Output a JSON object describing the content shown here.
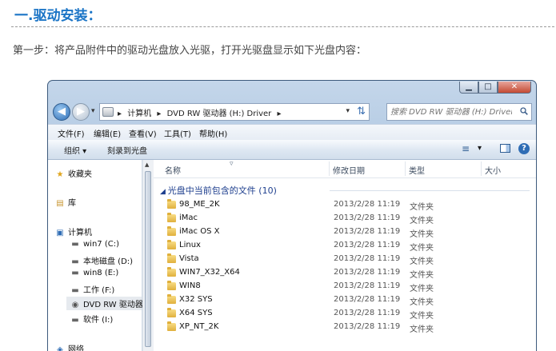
{
  "article": {
    "heading": "一.驱动安装：",
    "step_text": "第一步：将产品附件中的驱动光盘放入光驱，打开光驱盘显示如下光盘内容："
  },
  "window": {
    "controls": {
      "minimize": "▁",
      "maximize": "□",
      "close": "✕"
    },
    "address": {
      "crumbs": [
        "▸",
        "计算机",
        "▸",
        "DVD RW 驱动器 (H:) Driver",
        "▸"
      ]
    },
    "search": {
      "placeholder": "搜索 DVD RW 驱动器 (H:) Driver"
    },
    "menu": [
      "文件(F)",
      "编辑(E)",
      "查看(V)",
      "工具(T)",
      "帮助(H)"
    ],
    "toolbar": {
      "organize": "组织 ▾",
      "burn": "刻录到光盘",
      "views_arrow": "▾",
      "help": "?"
    },
    "nav": {
      "favorites": "收藏夹",
      "library": "库",
      "computer": "计算机",
      "drives": [
        "win7 (C:)",
        "本地磁盘 (D:)",
        "win8 (E:)",
        "工作 (F:)",
        "DVD RW 驱动器",
        "软件 (I:)"
      ],
      "network": "网络"
    },
    "columns": {
      "name": "名称",
      "modified": "修改日期",
      "type": "类型",
      "size": "大小"
    },
    "group_label": "光盘中当前包含的文件 (10)",
    "files": [
      {
        "name": "98_ME_2K",
        "date": "2013/2/28 11:19",
        "type": "文件夹"
      },
      {
        "name": "iMac",
        "date": "2013/2/28 11:19",
        "type": "文件夹"
      },
      {
        "name": "iMac OS X",
        "date": "2013/2/28 11:19",
        "type": "文件夹"
      },
      {
        "name": "Linux",
        "date": "2013/2/28 11:19",
        "type": "文件夹"
      },
      {
        "name": "Vista",
        "date": "2013/2/28 11:19",
        "type": "文件夹"
      },
      {
        "name": "WIN7_X32_X64",
        "date": "2013/2/28 11:19",
        "type": "文件夹"
      },
      {
        "name": "WIN8",
        "date": "2013/2/28 11:19",
        "type": "文件夹"
      },
      {
        "name": "X32 SYS",
        "date": "2013/2/28 11:19",
        "type": "文件夹"
      },
      {
        "name": "X64 SYS",
        "date": "2013/2/28 11:19",
        "type": "文件夹"
      },
      {
        "name": "XP_NT_2K",
        "date": "2013/2/28 11:19",
        "type": "文件夹"
      }
    ]
  }
}
